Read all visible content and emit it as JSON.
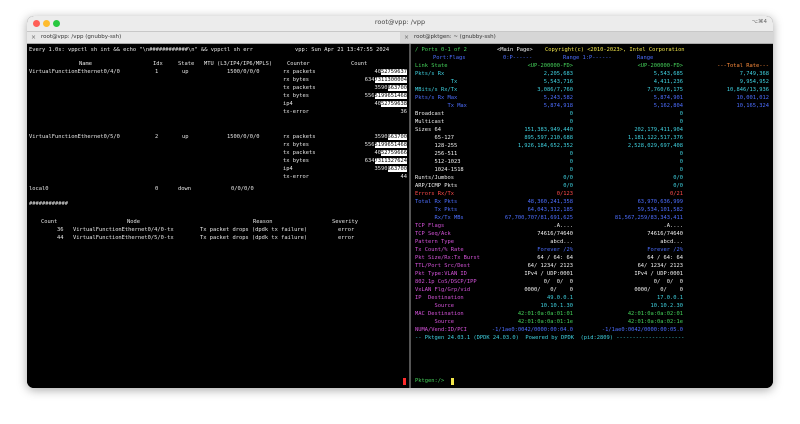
{
  "window": {
    "title": "root@vpp: /vpp",
    "shortcut": "⌥⌘4",
    "colors": {
      "close": "#ff5f57",
      "minimize": "#febc2e",
      "zoom": "#28c840"
    }
  },
  "tabs": [
    {
      "label": "root@vpp: /vpp (gnubby-ssh)"
    },
    {
      "label": "root@pktgen: ~ (gnubby-ssh)"
    }
  ],
  "left": {
    "header": "Every 1.0s: vppctl sh int && echo \"\\n############\\n\" && vppctl sh err",
    "header_right": "vpp: Sun Apr 21 13:47:55 2024",
    "col_headers": {
      "name": "Name",
      "idx": "Idx",
      "state": "State",
      "mtu": "MTU (L3/IP4/IP6/MPLS)",
      "counter": "Counter",
      "count": "Count"
    },
    "iface1": {
      "name": "VirtualFunctionEthernet0/4/0",
      "idx": "1",
      "state": "up",
      "mtu": "1500/0/0/0"
    },
    "iface1_rows": [
      {
        "counter": "rx packets",
        "a": "40",
        "b": "52759637"
      },
      {
        "counter": "rx bytes",
        "a": "634",
        "b": "7311300004"
      },
      {
        "counter": "tx packets",
        "a": "3590",
        "b": "663700"
      },
      {
        "counter": "tx bytes",
        "a": "556",
        "b": "5199651468"
      },
      {
        "counter": "ip4",
        "a": "40",
        "b": "52759638"
      },
      {
        "counter": "tx-error",
        "a": "",
        "b": "36"
      }
    ],
    "iface2": {
      "name": "VirtualFunctionEthernet0/5/0",
      "idx": "2",
      "state": "up",
      "mtu": "1500/0/0/0"
    },
    "iface2_rows": [
      {
        "counter": "rx packets",
        "a": "3590",
        "b": "663700"
      },
      {
        "counter": "rx bytes",
        "a": "556",
        "b": "5199651468"
      },
      {
        "counter": "tx packets",
        "a": "40",
        "b": "52759666"
      },
      {
        "counter": "tx bytes",
        "a": "634",
        "b": "7311327624"
      },
      {
        "counter": "ip4",
        "a": "3590",
        "b": "663700"
      },
      {
        "counter": "tx-error",
        "a": "",
        "b": "44"
      }
    ],
    "local0": {
      "name": "local0",
      "idx": "0",
      "state": "down",
      "mtu": "0/0/0/0"
    },
    "separator": "############",
    "err_headers": {
      "count": "Count",
      "node": "Node",
      "reason": "Reason",
      "severity": "Severity"
    },
    "errors": [
      {
        "count": "36",
        "node": "VirtualFunctionEthernet0/4/0-tx",
        "reason": "Tx packet drops (dpdk tx failure)",
        "severity": "error"
      },
      {
        "count": "44",
        "node": "VirtualFunctionEthernet0/5/0-tx",
        "reason": "Tx packet drops (dpdk tx failure)",
        "severity": "error"
      }
    ]
  },
  "right": {
    "ports_label": "/ Ports 0-1 of 2",
    "main_page": "<Main Page>",
    "copyright": "Copyright(c) <2010-2023>, Intel Corporation",
    "flags_label": "Port:Flags",
    "port0_hdr": "0:P------",
    "single0": "Single",
    "port1_hdr": "Range 1:P------",
    "single1": "Range",
    "rows": [
      {
        "label": "Link State",
        "p0": "<UP-200000-FD>",
        "p1": "<UP-200000-FD>",
        "total": "---Total Rate---",
        "lc": "g",
        "vc": "g",
        "tc": "o"
      },
      {
        "label": "Pkts/s Rx",
        "p0": "2,205,683",
        "p1": "5,543,685",
        "total": "7,749,368",
        "lc": "c",
        "vc": "c",
        "tc": "c"
      },
      {
        "label": "           Tx",
        "p0": "5,543,716",
        "p1": "4,411,236",
        "total": "9,954,952",
        "lc": "c",
        "vc": "c",
        "tc": "c"
      },
      {
        "label": "MBits/s Rx/Tx",
        "p0": "3,086/7,760",
        "p1": "7,760/6,175",
        "total": "10,846/13,936",
        "lc": "c",
        "vc": "c",
        "tc": "c"
      },
      {
        "label": "Pkts/s Rx Max",
        "p0": "5,243,582",
        "p1": "5,874,901",
        "total": "10,001,012",
        "lc": "b",
        "vc": "b",
        "tc": "b"
      },
      {
        "label": "          Tx Max",
        "p0": "5,874,918",
        "p1": "5,162,804",
        "total": "10,165,324",
        "lc": "b",
        "vc": "b",
        "tc": "b"
      },
      {
        "label": "Broadcast",
        "p0": "0",
        "p1": "0",
        "total": "",
        "lc": "w",
        "vc": "c",
        "tc": "c"
      },
      {
        "label": "Multicast",
        "p0": "0",
        "p1": "0",
        "total": "",
        "lc": "w",
        "vc": "c",
        "tc": "c"
      },
      {
        "label": "Sizes 64",
        "p0": "151,383,949,440",
        "p1": "202,179,411,904",
        "total": "",
        "lc": "w",
        "vc": "c",
        "tc": "c"
      },
      {
        "label": "      65-127",
        "p0": "895,597,210,688",
        "p1": "1,181,122,517,376",
        "total": "",
        "lc": "w",
        "vc": "c",
        "tc": "c"
      },
      {
        "label": "      128-255",
        "p0": "1,926,184,652,352",
        "p1": "2,528,029,697,408",
        "total": "",
        "lc": "w",
        "vc": "c",
        "tc": "c"
      },
      {
        "label": "      256-511",
        "p0": "0",
        "p1": "0",
        "total": "",
        "lc": "w",
        "vc": "c",
        "tc": "c"
      },
      {
        "label": "      512-1023",
        "p0": "0",
        "p1": "0",
        "total": "",
        "lc": "w",
        "vc": "c",
        "tc": "c"
      },
      {
        "label": "      1024-1518",
        "p0": "0",
        "p1": "0",
        "total": "",
        "lc": "w",
        "vc": "c",
        "tc": "c"
      },
      {
        "label": "Runts/Jumbos",
        "p0": "0/0",
        "p1": "0/0",
        "total": "",
        "lc": "w",
        "vc": "c",
        "tc": "c"
      },
      {
        "label": "ARP/ICMP Pkts",
        "p0": "0/0",
        "p1": "0/0",
        "total": "",
        "lc": "w",
        "vc": "c",
        "tc": "c"
      },
      {
        "label": "Errors Rx/Tx",
        "p0": "0/123",
        "p1": "0/21",
        "total": "",
        "lc": "r",
        "vc": "r",
        "tc": "r"
      },
      {
        "label": "Total Rx Pkts",
        "p0": "48,360,241,358",
        "p1": "63,970,636,999",
        "total": "",
        "lc": "b",
        "vc": "b",
        "tc": "b"
      },
      {
        "label": "      Tx Pkts",
        "p0": "64,043,312,185",
        "p1": "59,534,101,582",
        "total": "",
        "lc": "b",
        "vc": "b",
        "tc": "b"
      },
      {
        "label": "      Rx/Tx MBs",
        "p0": "67,700,707/81,691,625",
        "p1": "81,567,259/83,343,411",
        "total": "",
        "lc": "b",
        "vc": "b",
        "tc": "b"
      },
      {
        "label": "TCP Flags",
        "p0": ".A....",
        "p1": ".A....",
        "total": "",
        "lc": "m",
        "vc": "w",
        "tc": "w"
      },
      {
        "label": "TCP Seq/Ack",
        "p0": "74616/74640",
        "p1": "74616/74640",
        "total": "",
        "lc": "m",
        "vc": "w",
        "tc": "w"
      },
      {
        "label": "Pattern Type",
        "p0": "abcd...",
        "p1": "abcd...",
        "total": "",
        "lc": "m",
        "vc": "w",
        "tc": "w"
      },
      {
        "label": "Tx Count/% Rate",
        "p0": "Forever /2%",
        "p1": "Forever /2%",
        "total": "",
        "lc": "m",
        "vc": "b",
        "tc": "b"
      },
      {
        "label": "Pkt Size/Rx:Tx Burst",
        "p0": "64 / 64: 64",
        "p1": "64 / 64: 64",
        "total": "",
        "lc": "m",
        "vc": "w",
        "tc": "w"
      },
      {
        "label": "TTL/Port Src/Dest",
        "p0": "64/ 1234/ 2123",
        "p1": "64/ 1234/ 2123",
        "total": "",
        "lc": "m",
        "vc": "w",
        "tc": "w"
      },
      {
        "label": "Pkt Type:VLAN ID",
        "p0": "IPv4 / UDP:0001",
        "p1": "IPv4 / UDP:0001",
        "total": "",
        "lc": "m",
        "vc": "w",
        "tc": "w"
      },
      {
        "label": "802.1p CoS/DSCP/IPP",
        "p0": "0/  0/  0",
        "p1": "0/  0/  0",
        "total": "",
        "lc": "m",
        "vc": "w",
        "tc": "w"
      },
      {
        "label": "VxLAN Flg/Grp/vid",
        "p0": "0000/   0/    0",
        "p1": "0000/   0/    0",
        "total": "",
        "lc": "m",
        "vc": "w",
        "tc": "w"
      },
      {
        "label": "IP  Destination",
        "p0": "49.0.0.1",
        "p1": "17.0.0.1",
        "total": "",
        "lc": "m",
        "vc": "c",
        "tc": "c"
      },
      {
        "label": "      Source",
        "p0": "10.10.1.30",
        "p1": "10.10.2.30",
        "total": "",
        "lc": "m",
        "vc": "c",
        "tc": "c"
      },
      {
        "label": "MAC Destination",
        "p0": "42:01:0a:0a:01:01",
        "p1": "42:01:0a:0a:02:01",
        "total": "",
        "lc": "m",
        "vc": "g",
        "tc": "g"
      },
      {
        "label": "      Source",
        "p0": "42:01:0a:0a:01:1e",
        "p1": "42:01:0a:0a:02:1e",
        "total": "",
        "lc": "m",
        "vc": "g",
        "tc": "g"
      },
      {
        "label": "NUMA/Vend:ID/PCI",
        "p0": "-1/1ae0:0042/0000:00:04.0",
        "p1": "-1/1ae0:0042/0000:00:05.0",
        "total": "",
        "lc": "m",
        "vc": "b",
        "tc": "b"
      }
    ],
    "footer": "-- Pktgen 24.03.1 (DPDK 24.03.0)  Powered by DPDK  (pid:2809) ---------------------",
    "prompt": "Pktgen:/> "
  }
}
